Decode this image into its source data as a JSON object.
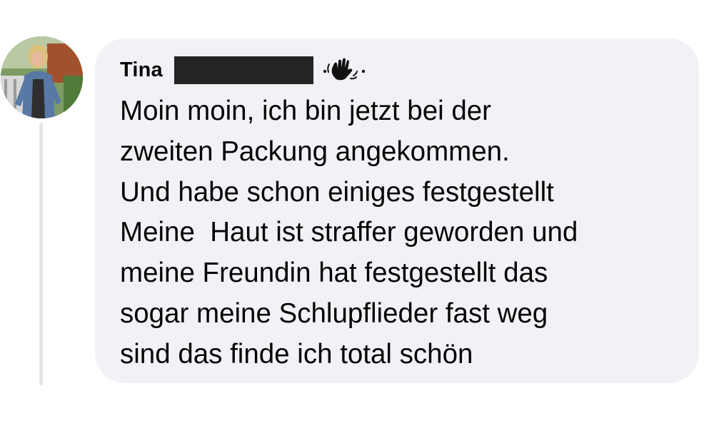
{
  "comment": {
    "author": {
      "name": "Tina",
      "name_redacted": true,
      "badge_icon": "waving-hand-icon"
    },
    "avatar_icon": "profile-photo",
    "body_lines": [
      "Moin moin, ich bin jetzt bei der",
      "zweiten Packung angekommen.",
      "Und habe schon einiges festgestellt",
      "Meine  Haut ist straffer geworden und",
      "meine Freundin hat festgestellt das",
      "sogar meine Schlupflieder fast weg",
      "sind das finde ich total schön"
    ]
  },
  "colors": {
    "bubble_background": "#f0f2f5",
    "thread_line": "#e4e6eb",
    "text": "#050505",
    "redaction": "#242424"
  }
}
